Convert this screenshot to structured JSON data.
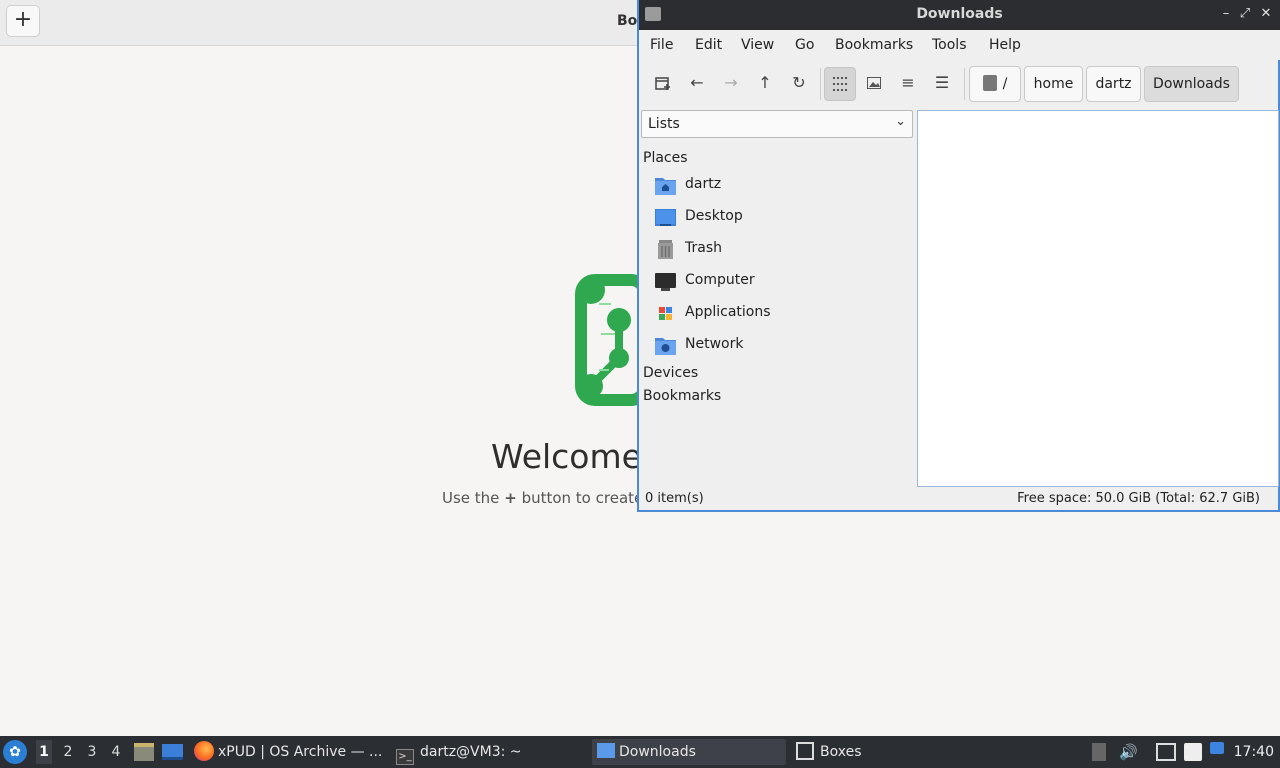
{
  "boxes": {
    "title": "Bo",
    "add_label": "+",
    "welcome": "Welcome",
    "hint_prefix": "Use the",
    "hint_plus": "+",
    "hint_suffix": "button to create"
  },
  "window": {
    "title": "Downloads",
    "controls": {
      "minimize": "–",
      "maximize": "⤢",
      "close": "✕"
    }
  },
  "menu": [
    "File",
    "Edit",
    "View",
    "Go",
    "Bookmarks",
    "Tools",
    "Help"
  ],
  "toolbar": {
    "new_tab_icon": "new-tab-icon",
    "back_icon": "back-arrow-icon",
    "forward_icon": "forward-arrow-icon",
    "up_icon": "up-arrow-icon",
    "reload_icon": "reload-icon",
    "view_icons": "icon-view-icon",
    "view_thumbnails": "thumbnail-view-icon",
    "view_compact": "compact-view-icon",
    "view_detailed": "detailed-list-view-icon"
  },
  "path": {
    "root": "/",
    "parts": [
      "home",
      "dartz",
      "Downloads"
    ]
  },
  "sidebar": {
    "mode": "Lists",
    "sections": {
      "places": "Places",
      "devices": "Devices",
      "bookmarks": "Bookmarks"
    },
    "places": [
      {
        "label": "dartz",
        "icon": "home-folder-icon"
      },
      {
        "label": "Desktop",
        "icon": "desktop-icon"
      },
      {
        "label": "Trash",
        "icon": "trash-icon"
      },
      {
        "label": "Computer",
        "icon": "computer-icon"
      },
      {
        "label": "Applications",
        "icon": "applications-icon"
      },
      {
        "label": "Network",
        "icon": "network-folder-icon"
      }
    ]
  },
  "status": {
    "items": "0 item(s)",
    "space": "Free space: 50.0 GiB (Total: 62.7 GiB)"
  },
  "taskbar": {
    "workspaces": [
      "1",
      "2",
      "3",
      "4"
    ],
    "tasks": [
      {
        "label": "xPUD | OS Archive — ...",
        "icon": "firefox-icon"
      },
      {
        "label": "dartz@VM3: ~",
        "icon": "terminal-icon"
      },
      {
        "label": "Downloads",
        "icon": "folder-icon"
      },
      {
        "label": "Boxes",
        "icon": "boxes-icon"
      }
    ],
    "clock": "17:40"
  },
  "colors": {
    "accent": "#4a8ad6",
    "titlebar": "#2b2d31",
    "taskbar": "#2b2e33",
    "logo_green": "#2fa84f"
  }
}
